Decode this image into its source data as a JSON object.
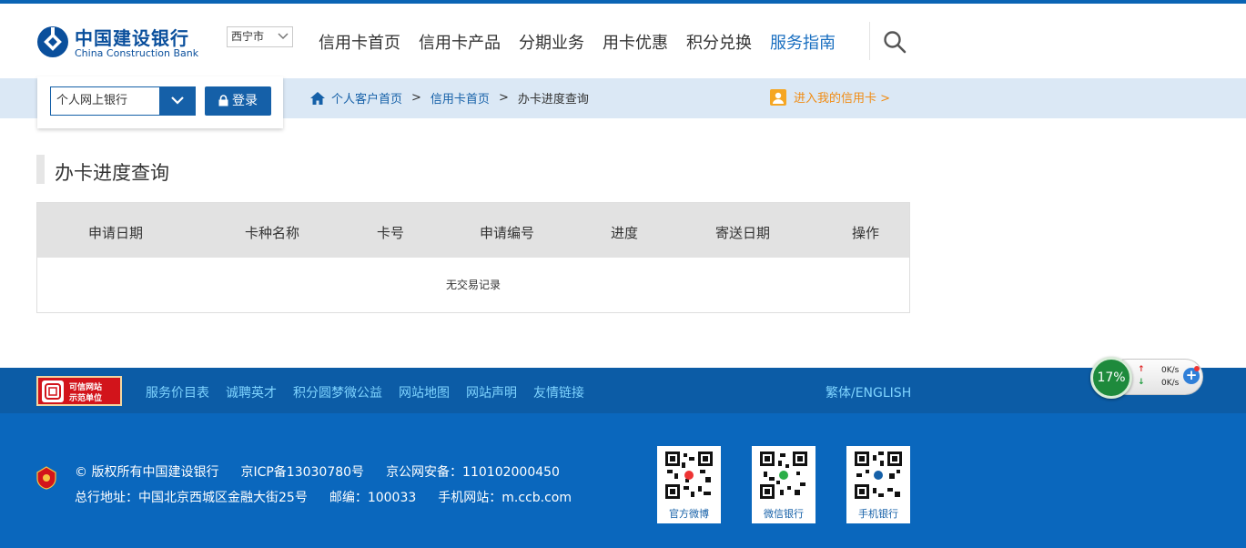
{
  "header": {
    "logo_cn": "中国建设银行",
    "logo_en": "China Construction Bank",
    "city": "西宁市",
    "nav": [
      {
        "label": "信用卡首页"
      },
      {
        "label": "信用卡产品"
      },
      {
        "label": "分期业务"
      },
      {
        "label": "用卡优惠"
      },
      {
        "label": "积分兑换"
      },
      {
        "label": "服务指南"
      }
    ],
    "active_nav": "服务指南"
  },
  "login": {
    "select_value": "个人网上银行",
    "button_label": "登录"
  },
  "breadcrumb": {
    "items": [
      "个人客户首页",
      "信用卡首页",
      "办卡进度查询"
    ],
    "separator": ">"
  },
  "mycard_link": "进入我的信用卡 >",
  "page_title": "办卡进度查询",
  "table": {
    "columns": [
      "申请日期",
      "卡种名称",
      "卡号",
      "申请编号",
      "进度",
      "寄送日期",
      "操作"
    ],
    "empty_text": "无交易记录"
  },
  "footer_nav": {
    "badge_line1": "可信网站",
    "badge_line2": "示范单位",
    "links": [
      "服务价目表",
      "诚聘英才",
      "积分圆梦微公益",
      "网站地图",
      "网站声明",
      "友情链接"
    ],
    "language": "繁体/ENGLISH"
  },
  "footer": {
    "copyright": "© 版权所有中国建设银行",
    "icp": "京ICP备13030780号",
    "police": "京公网安备：110102000450",
    "address": "总行地址：中国北京西城区金融大街25号",
    "postcode": "邮编：100033",
    "mobile_site": "手机网站：m.ccb.com",
    "qr_codes": [
      "官方微博",
      "微信银行",
      "手机银行"
    ]
  },
  "speed_widget": {
    "percent": "17%",
    "upload": "0K/s",
    "download": "0K/s"
  },
  "colors": {
    "brand_blue": "#0a67bd",
    "accent_orange": "#f08c14",
    "link_cyan": "#7fd4ff"
  },
  "icons": [
    "ccb-logo-icon",
    "chevron-down-icon",
    "search-icon",
    "lock-icon",
    "home-icon",
    "user-icon",
    "emblem-icon",
    "qr-code-icon"
  ]
}
